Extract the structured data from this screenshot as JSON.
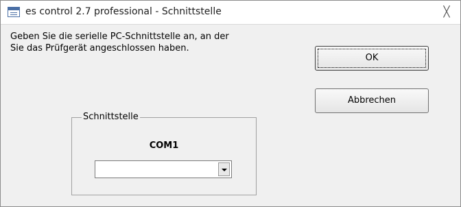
{
  "window": {
    "title": "es control 2.7 professional - Schnittstelle",
    "close_glyph": "╳"
  },
  "message": {
    "line1": "Geben Sie die serielle PC-Schnittstelle an, an der",
    "line2": "Sie das Prüfgerät angeschlossen haben."
  },
  "buttons": {
    "ok_label": "OK",
    "cancel_label": "Abbrechen"
  },
  "group": {
    "legend": "Schnittstelle",
    "current_port": "COM1",
    "dropdown_value": ""
  }
}
